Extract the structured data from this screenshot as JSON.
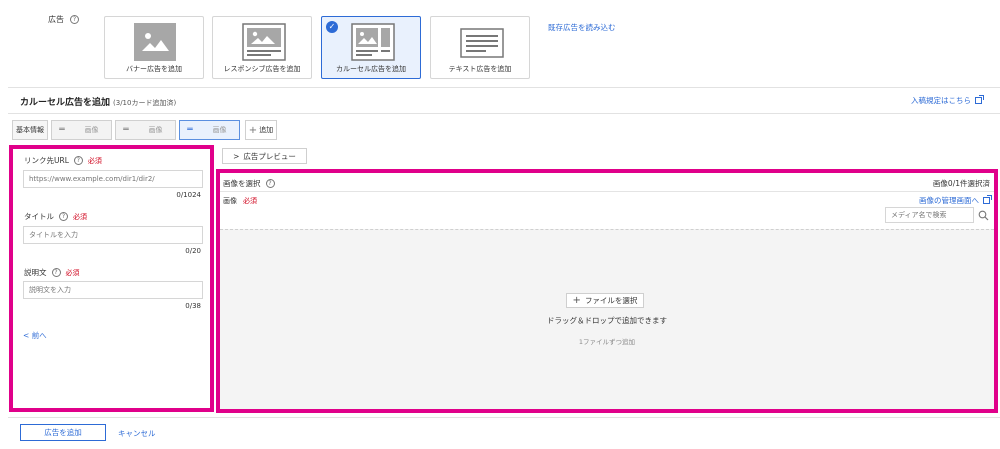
{
  "ad_label": "広告",
  "ad_types": [
    {
      "label": "バナー広告を追加",
      "selected": false,
      "icon": "banner-image-icon"
    },
    {
      "label": "レスポンシブ広告を追加",
      "selected": false,
      "icon": "responsive-ad-icon"
    },
    {
      "label": "カルーセル広告を追加",
      "selected": true,
      "icon": "carousel-ad-icon"
    },
    {
      "label": "テキスト広告を追加",
      "selected": false,
      "icon": "text-ad-icon"
    }
  ],
  "load_existing": "既存広告を読み込む",
  "section": {
    "title": "カルーセル広告を追加",
    "subtitle": "(3/10カード追加済)",
    "entry_link": "入稿規定はこちら"
  },
  "tabs": {
    "basic": "基本情報",
    "image_tabs": [
      "画像",
      "画像",
      "画像"
    ],
    "add": "追加"
  },
  "form": {
    "url_label": "リンク先URL",
    "url_placeholder": "https://www.example.com/dir1/dir2/",
    "url_counter": "0/1024",
    "title_label": "タイトル",
    "title_placeholder": "タイトルを入力",
    "title_counter": "0/20",
    "desc_label": "説明文",
    "desc_placeholder": "説明文を入力",
    "desc_counter": "0/38",
    "required": "必須",
    "back": "前へ"
  },
  "preview_button": "広告プレビュー",
  "image_select": {
    "title": "画像を選択",
    "count": "画像0/1件選択済",
    "image_label": "画像",
    "required": "必須",
    "mgmt_link": "画像の管理画面へ",
    "search_placeholder": "メディア名で検索",
    "file_button": "ファイルを選択",
    "drop_text": "ドラッグ＆ドロップで追加できます",
    "drop_sub": "1ファイルずつ追加"
  },
  "footer": {
    "add_button": "広告を追加",
    "cancel": "キャンセル"
  },
  "colors": {
    "accent": "#2d6bd6",
    "highlight": "#e0008a",
    "required": "#d0021b"
  }
}
